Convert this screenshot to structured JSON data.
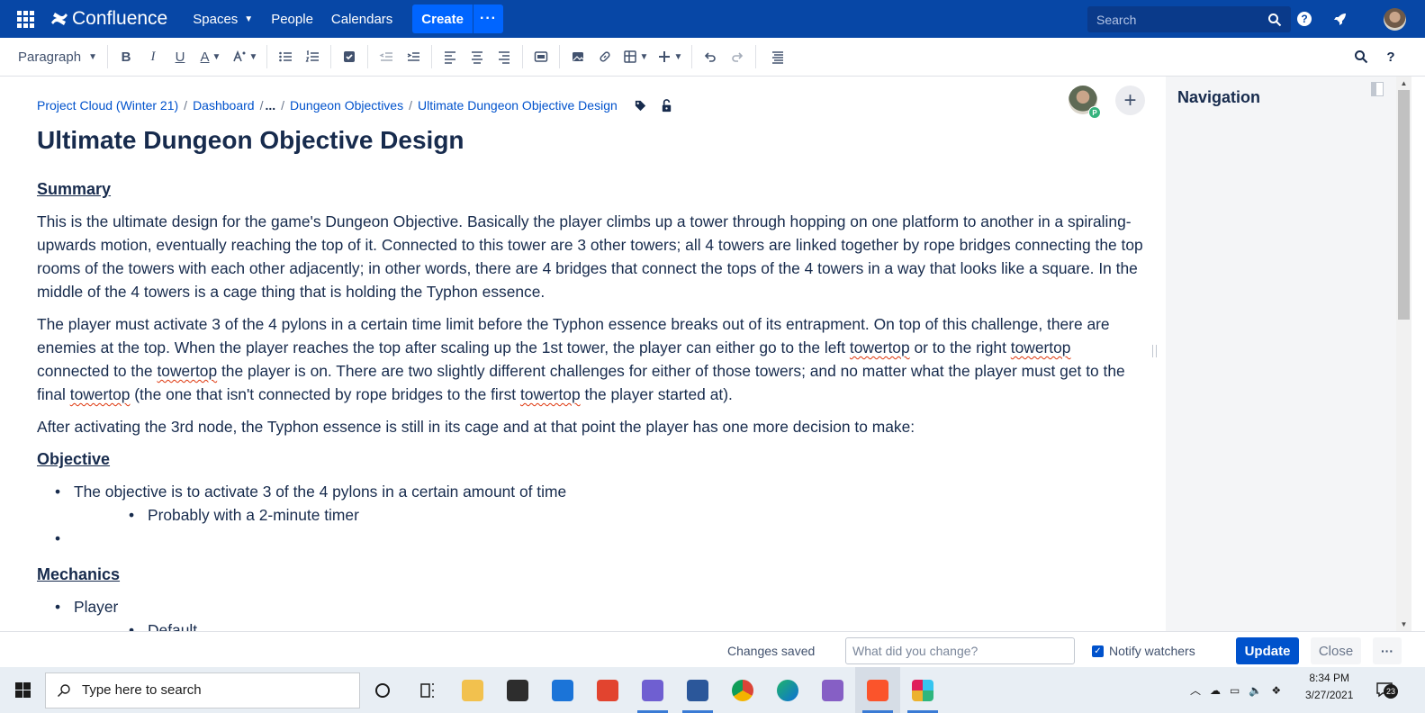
{
  "topnav": {
    "app_name": "Confluence",
    "items": [
      {
        "label": "Spaces",
        "has_dropdown": true
      },
      {
        "label": "People"
      },
      {
        "label": "Calendars"
      }
    ],
    "create_label": "Create",
    "more_label": "···",
    "search_placeholder": "Search",
    "help_label": "?",
    "colors": {
      "bar": "#0747a6",
      "create": "#0065ff"
    }
  },
  "toolbar": {
    "paragraph_style": "Paragraph",
    "bold": "B",
    "italic": "I",
    "underline": "U",
    "text_color": "A",
    "help": "?"
  },
  "breadcrumb": {
    "items": [
      "Project Cloud (Winter 21)",
      "Dashboard",
      "...",
      "Dungeon Objectives",
      "Ultimate Dungeon Objective Design"
    ]
  },
  "page": {
    "title": "Ultimate Dungeon Objective Design",
    "avatar_badge": "P",
    "add_label": "+",
    "summary_heading": "Summary",
    "summary_p1": "This is the ultimate design for the game's Dungeon Objective. Basically the player climbs up a tower through hopping on one platform to another in a spiraling-upwards motion, eventually reaching the top of it. Connected to this tower are 3 other towers; all 4 towers are linked together by rope bridges connecting the top rooms of the towers with each other adjacently; in other words, there are 4 bridges that connect the tops of the 4 towers in a way that looks like a square. In the middle of the 4 towers is a cage thing that is holding the Typhon essence.",
    "summary_p2": {
      "a": "The player must activate 3 of the 4 pylons in a certain time limit before the Typhon essence breaks out of its entrapment. On top of this challenge, there are enemies at the top. When the player reaches the top after scaling up the 1st tower, the player can either go to the left ",
      "w1": "towertop",
      "b": " or to the right ",
      "w2": "towertop",
      "c": " connected to the ",
      "w3": "towertop",
      "d": " the player is on. There are two slightly different challenges for either of those towers; and no matter what the player must get to the final ",
      "w4": "towertop",
      "e": " (the one that isn't connected by rope bridges to the first ",
      "w5": "towertop",
      "f": " the player started at)."
    },
    "summary_p3": "After activating the 3rd node, the Typhon essence is still in its cage and at that point the player has one more decision to make:",
    "objective_heading": "Objective",
    "objective_item1": "The objective is to activate 3 of the 4 pylons in a certain amount of time",
    "objective_sub1": "Probably with a 2-minute timer",
    "objective_item2": "",
    "mechanics_heading": "Mechanics",
    "mechanics_item1": "Player",
    "mechanics_sub1": "Default"
  },
  "sidebar": {
    "title": "Navigation"
  },
  "footer": {
    "status": "Changes saved",
    "change_placeholder": "What did you change?",
    "notify_label": "Notify watchers",
    "notify_checked": true,
    "update_label": "Update",
    "close_label": "Close",
    "more_label": "···"
  },
  "taskbar": {
    "search_placeholder": "Type here to search",
    "time": "8:34 PM",
    "date": "3/27/2021",
    "notification_count": "23"
  }
}
